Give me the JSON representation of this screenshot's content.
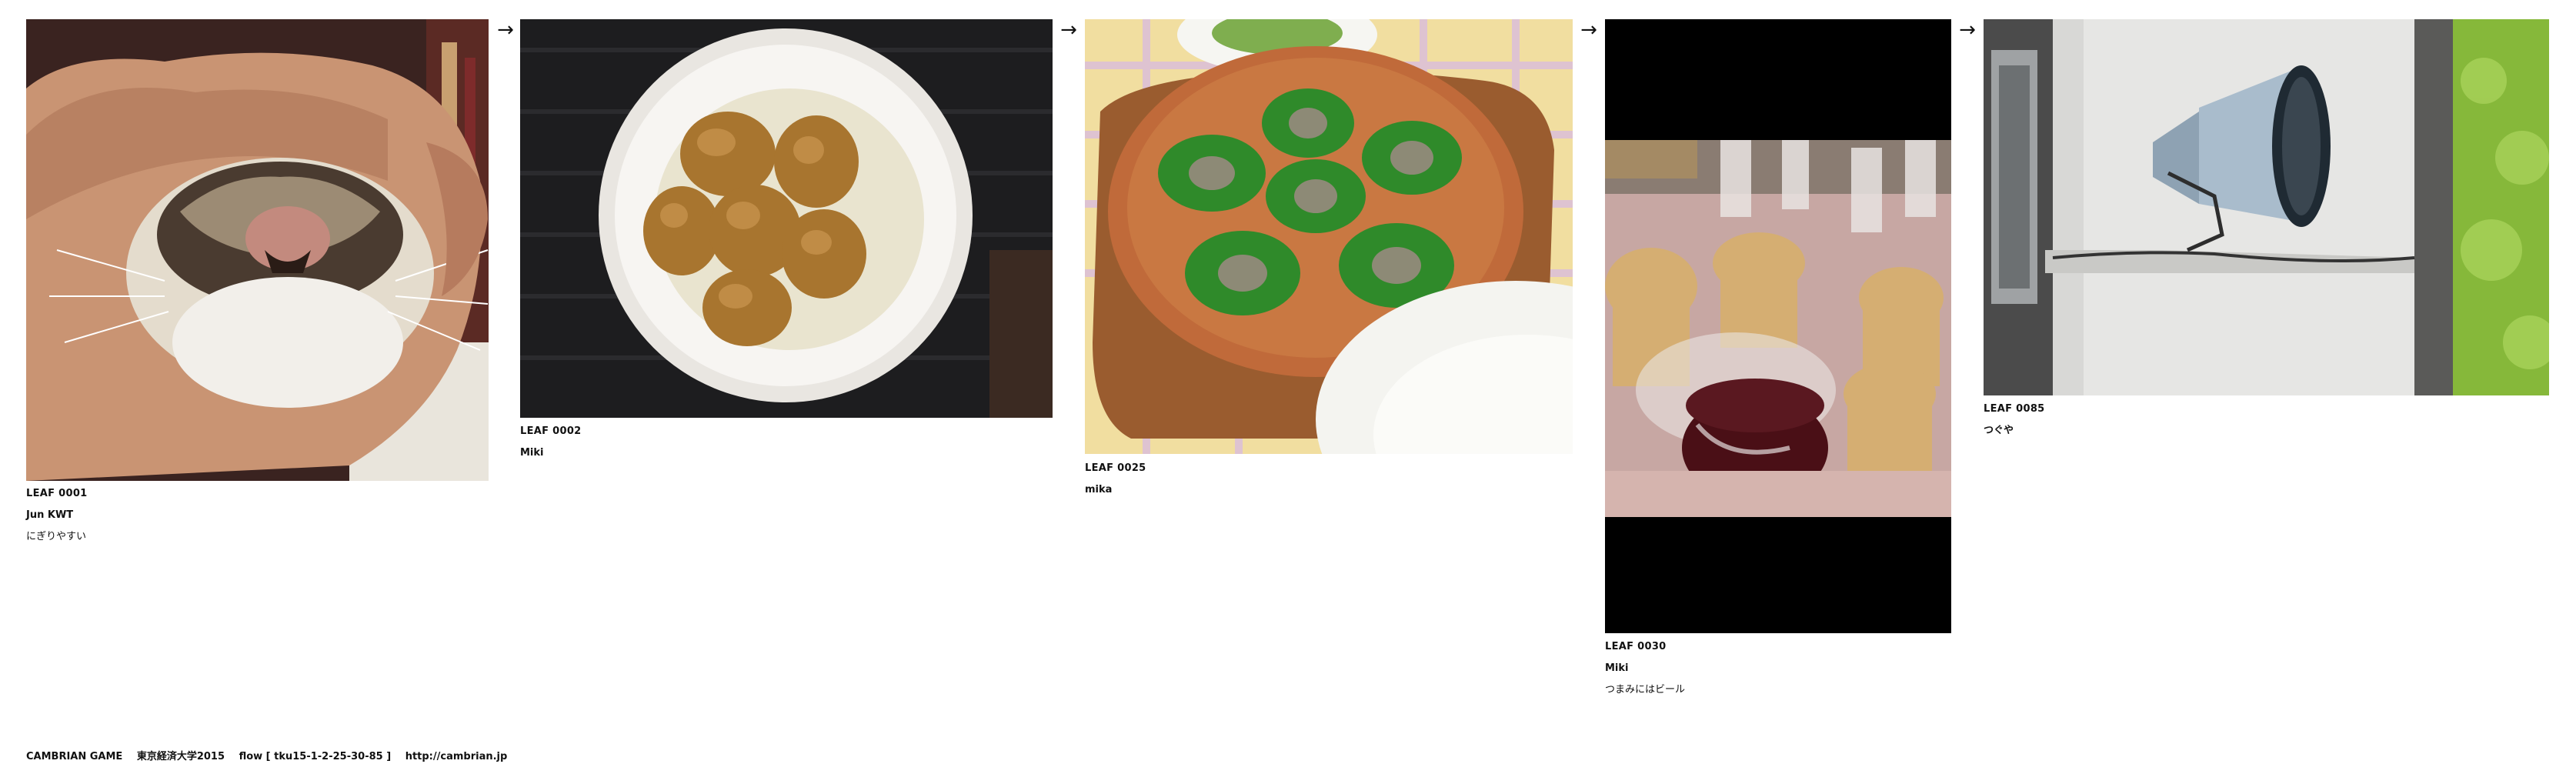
{
  "leaves": [
    {
      "id": "LEAF 0001",
      "author": "Jun KWT",
      "comment": "にぎりやすい",
      "photo": "cat-in-hand-photo"
    },
    {
      "id": "LEAF 0002",
      "author": "Miki",
      "comment": "",
      "photo": "simmered-potatoes-bowl-photo"
    },
    {
      "id": "LEAF 0025",
      "author": "mika",
      "comment": "",
      "photo": "escargot-dish-photo"
    },
    {
      "id": "LEAF 0030",
      "author": "Miki",
      "comment": "つまみにはビール",
      "photo": "beer-cups-photo"
    },
    {
      "id": "LEAF 0085",
      "author": "つぐや",
      "comment": "",
      "photo": "loudspeaker-photo"
    }
  ],
  "arrows": [
    "→",
    "→",
    "→",
    "→"
  ],
  "footer": {
    "title": "CAMBRIAN GAME",
    "event": "東京経済大学2015",
    "flow": "flow [ tku15-1-2-25-30-85 ]",
    "url": "http://cambrian.jp"
  },
  "colors": {
    "background": "#ffffff",
    "text": "#111111"
  }
}
